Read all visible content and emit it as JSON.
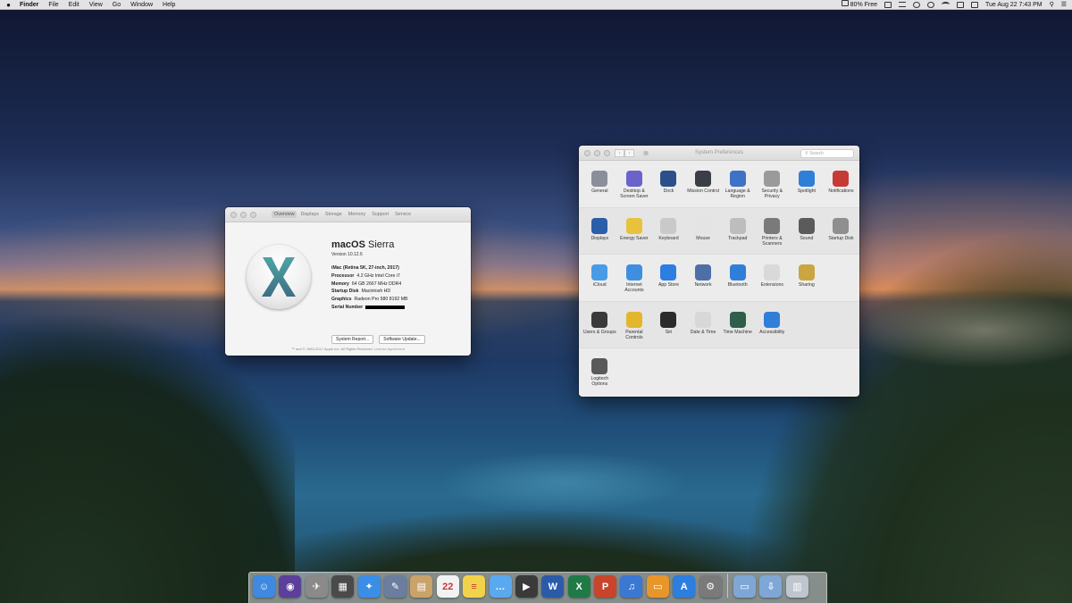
{
  "menubar": {
    "app": "Finder",
    "items": [
      "File",
      "Edit",
      "View",
      "Go",
      "Window",
      "Help"
    ],
    "battery": "80% Free",
    "datetime": "Tue Aug 22  7:43 PM"
  },
  "about": {
    "tabs": [
      "Overview",
      "Displays",
      "Storage",
      "Memory",
      "Support",
      "Service"
    ],
    "os_name_bold": "macOS",
    "os_name_rest": " Sierra",
    "version": "Version 10.12.6",
    "model": "iMac (Retina 5K, 27-inch, 2017)",
    "specs": [
      {
        "k": "Processor",
        "v": "4.2 GHz Intel Core i7"
      },
      {
        "k": "Memory",
        "v": "64 GB 2667 MHz DDR4"
      },
      {
        "k": "Startup Disk",
        "v": "Macintosh HD"
      },
      {
        "k": "Graphics",
        "v": "Radeon Pro 580 8192 MB"
      },
      {
        "k": "Serial Number",
        "v": ""
      }
    ],
    "buttons": [
      "System Report...",
      "Software Update..."
    ],
    "footer": "™ and © 1983-2017 Apple Inc. All Rights Reserved.",
    "footer_link": "License Agreement"
  },
  "syspref": {
    "title": "System Preferences",
    "search_placeholder": "Search",
    "rows": [
      [
        {
          "label": "General",
          "icon": "general-icon",
          "color": "#8a8f99"
        },
        {
          "label": "Desktop & Screen Saver",
          "icon": "desktop-icon",
          "color": "#6a63c9"
        },
        {
          "label": "Dock",
          "icon": "dock-icon",
          "color": "#2b4f8a"
        },
        {
          "label": "Mission Control",
          "icon": "mission-control-icon",
          "color": "#3a3f46"
        },
        {
          "label": "Language & Region",
          "icon": "language-icon",
          "color": "#3d72c4"
        },
        {
          "label": "Security & Privacy",
          "icon": "security-icon",
          "color": "#9a9a9a"
        },
        {
          "label": "Spotlight",
          "icon": "spotlight-icon",
          "color": "#2f7fd8"
        },
        {
          "label": "Notifications",
          "icon": "notifications-icon",
          "color": "#c73b36"
        }
      ],
      [
        {
          "label": "Displays",
          "icon": "displays-icon",
          "color": "#2b5ea8"
        },
        {
          "label": "Energy Saver",
          "icon": "energy-icon",
          "color": "#e7c23a"
        },
        {
          "label": "Keyboard",
          "icon": "keyboard-icon",
          "color": "#c9c9c9"
        },
        {
          "label": "Mouse",
          "icon": "mouse-icon",
          "color": "#e4e4e4"
        },
        {
          "label": "Trackpad",
          "icon": "trackpad-icon",
          "color": "#bdbdbd"
        },
        {
          "label": "Printers & Scanners",
          "icon": "printer-icon",
          "color": "#7a7a7a"
        },
        {
          "label": "Sound",
          "icon": "sound-icon",
          "color": "#5b5b5b"
        },
        {
          "label": "Startup Disk",
          "icon": "startup-disk-icon",
          "color": "#8f8f8f"
        }
      ],
      [
        {
          "label": "iCloud",
          "icon": "icloud-icon",
          "color": "#4a9be6"
        },
        {
          "label": "Internet Accounts",
          "icon": "internet-accounts-icon",
          "color": "#3f8fe0"
        },
        {
          "label": "App Store",
          "icon": "app-store-icon",
          "color": "#2c7ee0"
        },
        {
          "label": "Network",
          "icon": "network-icon",
          "color": "#4d6fa8"
        },
        {
          "label": "Bluetooth",
          "icon": "bluetooth-icon",
          "color": "#2f7fd8"
        },
        {
          "label": "Extensions",
          "icon": "extensions-icon",
          "color": "#d9d9d9"
        },
        {
          "label": "Sharing",
          "icon": "sharing-icon",
          "color": "#c9a642"
        }
      ],
      [
        {
          "label": "Users & Groups",
          "icon": "users-icon",
          "color": "#3a3a3a"
        },
        {
          "label": "Parental Controls",
          "icon": "parental-icon",
          "color": "#e3b72d"
        },
        {
          "label": "Siri",
          "icon": "siri-icon",
          "color": "#2b2b2b"
        },
        {
          "label": "Date & Time",
          "icon": "date-time-icon",
          "color": "#d8d8d8"
        },
        {
          "label": "Time Machine",
          "icon": "time-machine-icon",
          "color": "#2f5e4a"
        },
        {
          "label": "Accessibility",
          "icon": "accessibility-icon",
          "color": "#2f7fd8"
        }
      ],
      [
        {
          "label": "Logitech Options",
          "icon": "logitech-icon",
          "color": "#5a5a5a"
        }
      ]
    ]
  },
  "dock": {
    "apps": [
      {
        "name": "finder-icon",
        "color": "#3d8ae0",
        "glyph": "☺"
      },
      {
        "name": "siri-dock-icon",
        "color": "#5b3f9a",
        "glyph": "◉"
      },
      {
        "name": "launchpad-icon",
        "color": "#8a8a8a",
        "glyph": "✈"
      },
      {
        "name": "photo-slideshow-icon",
        "color": "#4a4a4a",
        "glyph": "▦"
      },
      {
        "name": "safari-icon",
        "color": "#3a8ee6",
        "glyph": "✦"
      },
      {
        "name": "preview-icon",
        "color": "#6b7ea0",
        "glyph": "✎"
      },
      {
        "name": "contacts-icon",
        "color": "#c9a36a",
        "glyph": "▤"
      },
      {
        "name": "calendar-icon",
        "color": "#f2f2f2",
        "glyph": "22"
      },
      {
        "name": "notes-icon",
        "color": "#f0d34a",
        "glyph": "≡"
      },
      {
        "name": "messages-icon",
        "color": "#5aa9ef",
        "glyph": "…"
      },
      {
        "name": "facetime-icon",
        "color": "#3a3a3a",
        "glyph": "▶"
      },
      {
        "name": "word-icon",
        "color": "#2b5aa8",
        "glyph": "W"
      },
      {
        "name": "excel-icon",
        "color": "#1f7a45",
        "glyph": "X"
      },
      {
        "name": "powerpoint-icon",
        "color": "#c8452b",
        "glyph": "P"
      },
      {
        "name": "itunes-icon",
        "color": "#3b78d4",
        "glyph": "♫"
      },
      {
        "name": "ibooks-icon",
        "color": "#e8962a",
        "glyph": "▭"
      },
      {
        "name": "app-store-dock-icon",
        "color": "#2c7ee0",
        "glyph": "A"
      },
      {
        "name": "system-preferences-dock-icon",
        "color": "#7a7a7a",
        "glyph": "⚙"
      }
    ],
    "stack": [
      {
        "name": "applications-folder-icon",
        "color": "#7fa7d6",
        "glyph": "▭"
      },
      {
        "name": "downloads-folder-icon",
        "color": "#7fa7d6",
        "glyph": "⇩"
      },
      {
        "name": "trash-icon",
        "color": "#bfc5cc",
        "glyph": "▥"
      }
    ]
  }
}
